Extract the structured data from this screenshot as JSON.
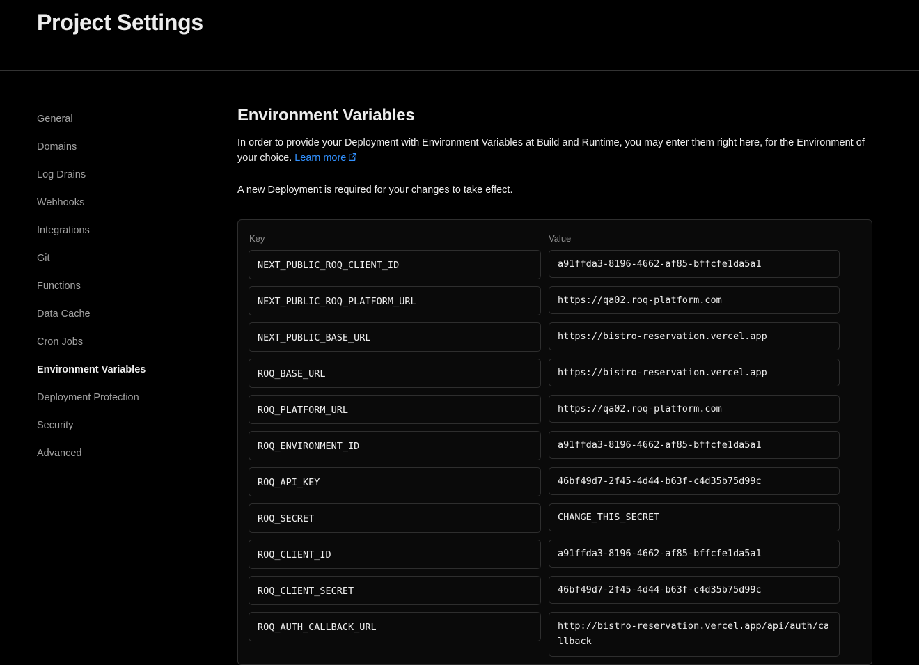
{
  "header": {
    "title": "Project Settings"
  },
  "sidebar": {
    "items": [
      {
        "label": "General"
      },
      {
        "label": "Domains"
      },
      {
        "label": "Log Drains"
      },
      {
        "label": "Webhooks"
      },
      {
        "label": "Integrations"
      },
      {
        "label": "Git"
      },
      {
        "label": "Functions"
      },
      {
        "label": "Data Cache"
      },
      {
        "label": "Cron Jobs"
      },
      {
        "label": "Environment Variables",
        "active": true
      },
      {
        "label": "Deployment Protection"
      },
      {
        "label": "Security"
      },
      {
        "label": "Advanced"
      }
    ]
  },
  "main": {
    "title": "Environment Variables",
    "description": "In order to provide your Deployment with Environment Variables at Build and Runtime, you may enter them right here, for the Environment of your choice.",
    "learn_more": "Learn more",
    "notice": "A new Deployment is required for your changes to take effect.",
    "columns": {
      "key": "Key",
      "value": "Value"
    },
    "variables": [
      {
        "key": "NEXT_PUBLIC_ROQ_CLIENT_ID",
        "value": "a91ffda3-8196-4662-af85-bffcfe1da5a1"
      },
      {
        "key": "NEXT_PUBLIC_ROQ_PLATFORM_URL",
        "value": "https://qa02.roq-platform.com"
      },
      {
        "key": "NEXT_PUBLIC_BASE_URL",
        "value": "https://bistro-reservation.vercel.app"
      },
      {
        "key": "ROQ_BASE_URL",
        "value": "https://bistro-reservation.vercel.app"
      },
      {
        "key": "ROQ_PLATFORM_URL",
        "value": "https://qa02.roq-platform.com"
      },
      {
        "key": "ROQ_ENVIRONMENT_ID",
        "value": "a91ffda3-8196-4662-af85-bffcfe1da5a1"
      },
      {
        "key": "ROQ_API_KEY",
        "value": "46bf49d7-2f45-4d44-b63f-c4d35b75d99c"
      },
      {
        "key": "ROQ_SECRET",
        "value": "CHANGE_THIS_SECRET"
      },
      {
        "key": "ROQ_CLIENT_ID",
        "value": "a91ffda3-8196-4662-af85-bffcfe1da5a1"
      },
      {
        "key": "ROQ_CLIENT_SECRET",
        "value": "46bf49d7-2f45-4d44-b63f-c4d35b75d99c"
      },
      {
        "key": "ROQ_AUTH_CALLBACK_URL",
        "value": "http://bistro-reservation.vercel.app/api/auth/callback"
      }
    ]
  },
  "colors": {
    "background": "#000000",
    "text": "#ededed",
    "muted": "#a1a1a1",
    "link": "#3291ff",
    "border": "#2e2e2e"
  },
  "icons": {
    "learn_more": "external-link-icon"
  }
}
